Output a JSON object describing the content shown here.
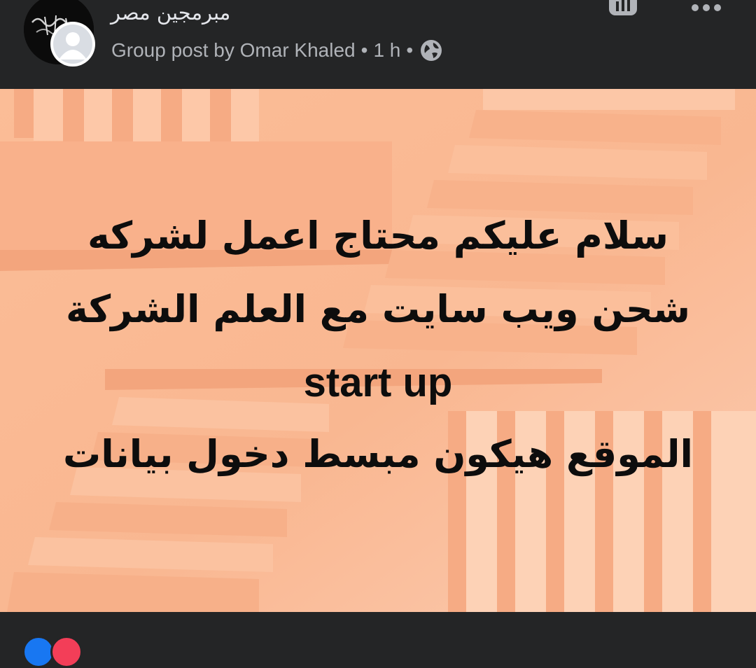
{
  "header": {
    "group_name": "مبرمجين مصر",
    "post_type_prefix": "Group post by",
    "author_name": "Omar Khaled",
    "separator": "•",
    "timestamp": "1 h",
    "audience_icon": "globe-icon",
    "insights_icon": "insights-icon",
    "more_icon": "more-options-icon"
  },
  "post": {
    "lines": [
      "سلام عليكم محتاج اعمل لشركه",
      "شحن ويب سايت مع العلم  الشركة",
      "start up",
      "الموقع هيكون مبسط دخول بيانات"
    ],
    "background_color": "#f9b893",
    "text_color": "#0d0d0d"
  },
  "footer": {
    "reaction_icons": [
      "like-reaction-icon",
      "love-reaction-icon"
    ],
    "reaction_colors": [
      "#1877f2",
      "#f33e58"
    ]
  },
  "colors": {
    "surface": "#242526",
    "primary_text": "#e4e6eb",
    "secondary_text": "#b0b3b8"
  }
}
